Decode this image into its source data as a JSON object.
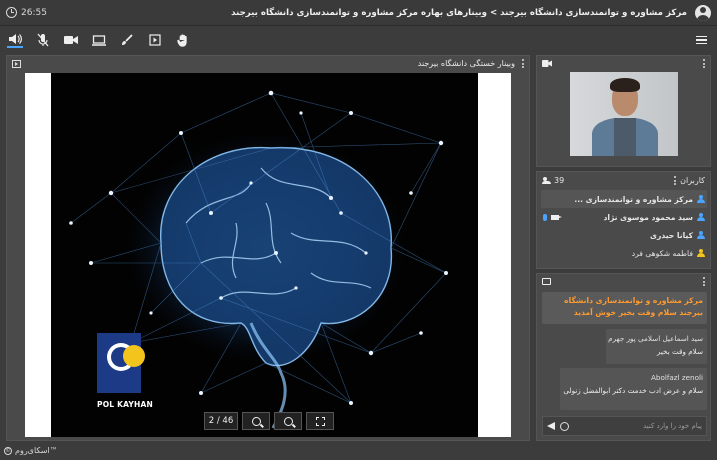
{
  "header": {
    "elapsed_time": "26:55",
    "breadcrumb": "مرکز مشاوره و توانمندسازی دانشگاه بیرجند > وبینارهای بهاره مرکز مشاوره و توانمندسازی دانشگاه بیرجند"
  },
  "toolbar": {
    "tools": [
      "speaker-icon",
      "mic-muted-icon",
      "camera-icon",
      "screen-share-icon",
      "brush-icon",
      "play-box-icon",
      "hand-icon"
    ],
    "accent": "#4aa3ff"
  },
  "presentation": {
    "title": "وبینار خستگی دانشگاه بیرجند",
    "page_indicator": "2 / 46",
    "logo_text": "POL KAYHAN"
  },
  "users": {
    "title": "کاربران",
    "count": "39",
    "list": [
      {
        "name": "مرکز مشاوره و توانمندسازی ...",
        "color": "#4aa3ff"
      },
      {
        "name": "سید محمود موسوی نژاد",
        "color": "#4aa3ff"
      },
      {
        "name": "کیانا حیدری",
        "color": "#4aa3ff"
      },
      {
        "name": "فاطمه شکوهی فرد",
        "color": "#f3c41c"
      }
    ]
  },
  "chat": {
    "welcome": "مرکز مشاوره و توانمندسازی دانشگاه بیرجند سلام وقت بخیر خوش آمدید",
    "messages": [
      {
        "name": "سید اسماعیل اسلامی پور جهرم",
        "text": "سلام وقت بخیر"
      },
      {
        "name": "Abolfazl zenoli",
        "text": "سلام و عرض ادب خدمت دکتر ابوالفضل زنولی"
      }
    ],
    "input_placeholder": "پیام خود را وارد کنید"
  },
  "footer": {
    "brand": "اسکای‌روم™"
  }
}
